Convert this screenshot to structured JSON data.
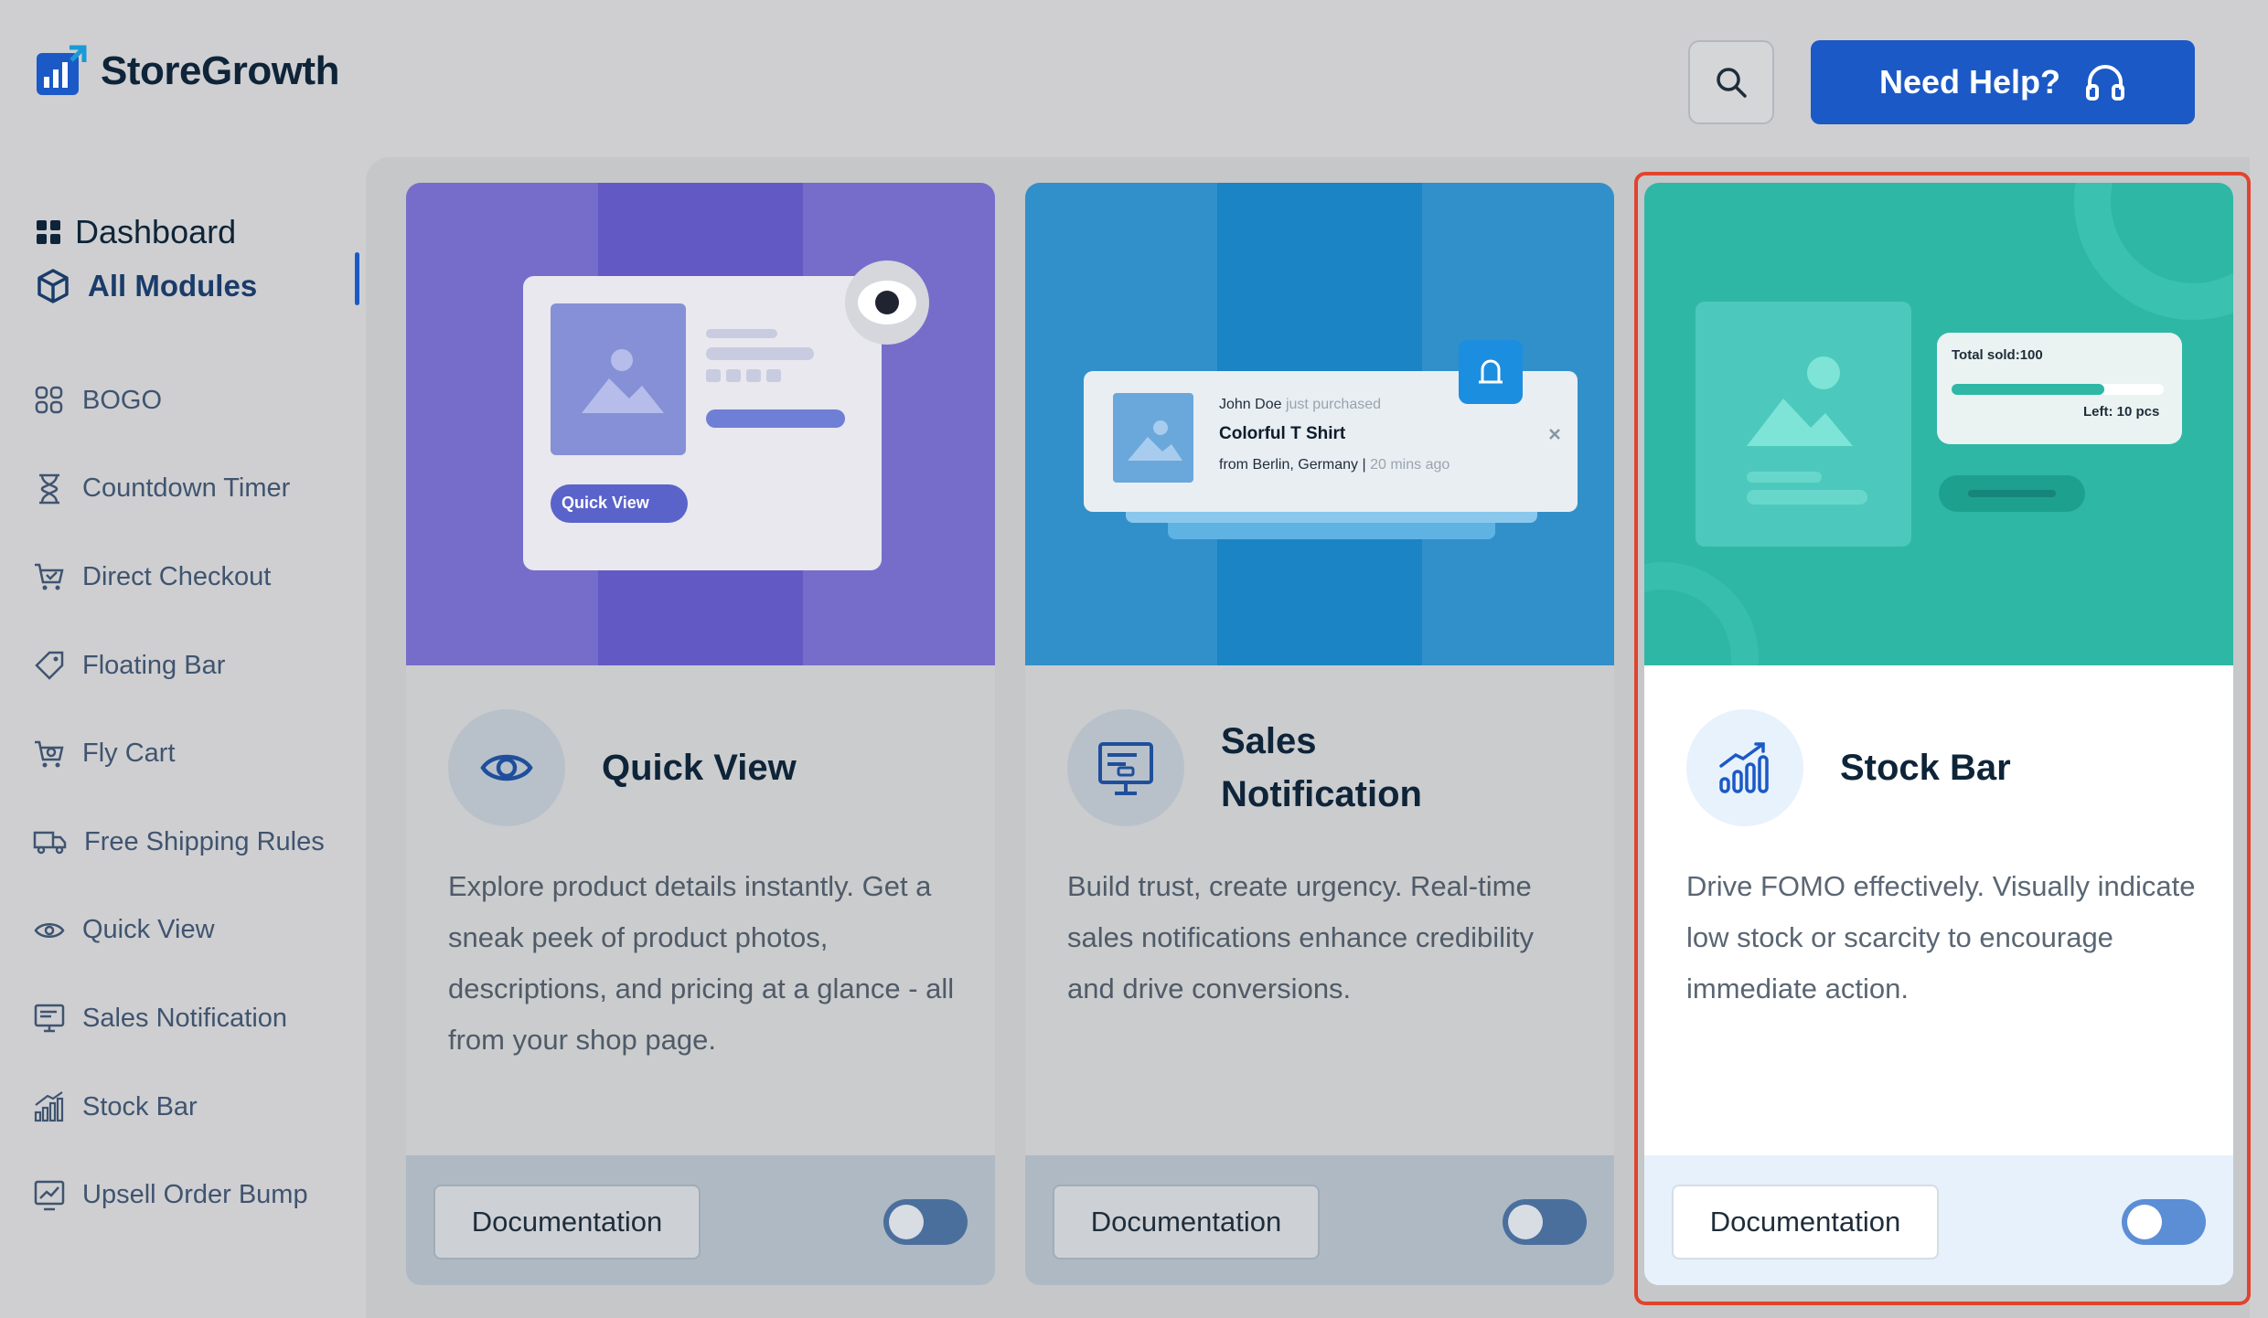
{
  "app": {
    "name": "StoreGrowth",
    "help_label": "Need Help?"
  },
  "sidebar": {
    "dashboard_label": "Dashboard",
    "all_modules_label": "All Modules",
    "items": [
      {
        "label": "BOGO",
        "icon": "bogo-icon"
      },
      {
        "label": "Countdown Timer",
        "icon": "hourglass-icon"
      },
      {
        "label": "Direct Checkout",
        "icon": "cart-check-icon"
      },
      {
        "label": "Floating Bar",
        "icon": "tag-icon"
      },
      {
        "label": "Fly Cart",
        "icon": "cart-icon"
      },
      {
        "label": "Free Shipping Rules",
        "icon": "truck-icon"
      },
      {
        "label": "Quick View",
        "icon": "eye-icon"
      },
      {
        "label": "Sales Notification",
        "icon": "monitor-icon"
      },
      {
        "label": "Stock Bar",
        "icon": "bar-chart-icon"
      },
      {
        "label": "Upsell Order Bump",
        "icon": "trend-icon"
      }
    ]
  },
  "cards": [
    {
      "title": "Quick View",
      "description": "Explore product details instantly. Get a sneak peek of product photos, descriptions, and pricing at a glance - all from your shop page.",
      "doc_label": "Documentation",
      "enabled": false,
      "banner": {
        "pill_label": "Quick View"
      }
    },
    {
      "title_line1": "Sales",
      "title_line2": "Notification",
      "description": "Build trust, create urgency. Real-time sales notifications enhance credibility and drive conversions.",
      "doc_label": "Documentation",
      "enabled": false,
      "banner": {
        "buyer": "John Doe",
        "action": "just purchased",
        "product": "Colorful T Shirt",
        "location": "from Berlin, Germany",
        "separator": "|",
        "time": "20 mins ago"
      }
    },
    {
      "title": "Stock Bar",
      "description": "Drive FOMO effectively. Visually indicate low stock or scarcity to encourage immediate action.",
      "doc_label": "Documentation",
      "enabled": false,
      "banner": {
        "total_sold": "Total sold:100",
        "left": "Left: 10 pcs",
        "progress": 0.72
      }
    }
  ],
  "colors": {
    "accent": "#1b59c6",
    "highlight": "#e0442e",
    "quick_view_banner": "#6359c4",
    "sales_banner": "#1a84c4",
    "stock_banner": "#2fb7a6"
  }
}
